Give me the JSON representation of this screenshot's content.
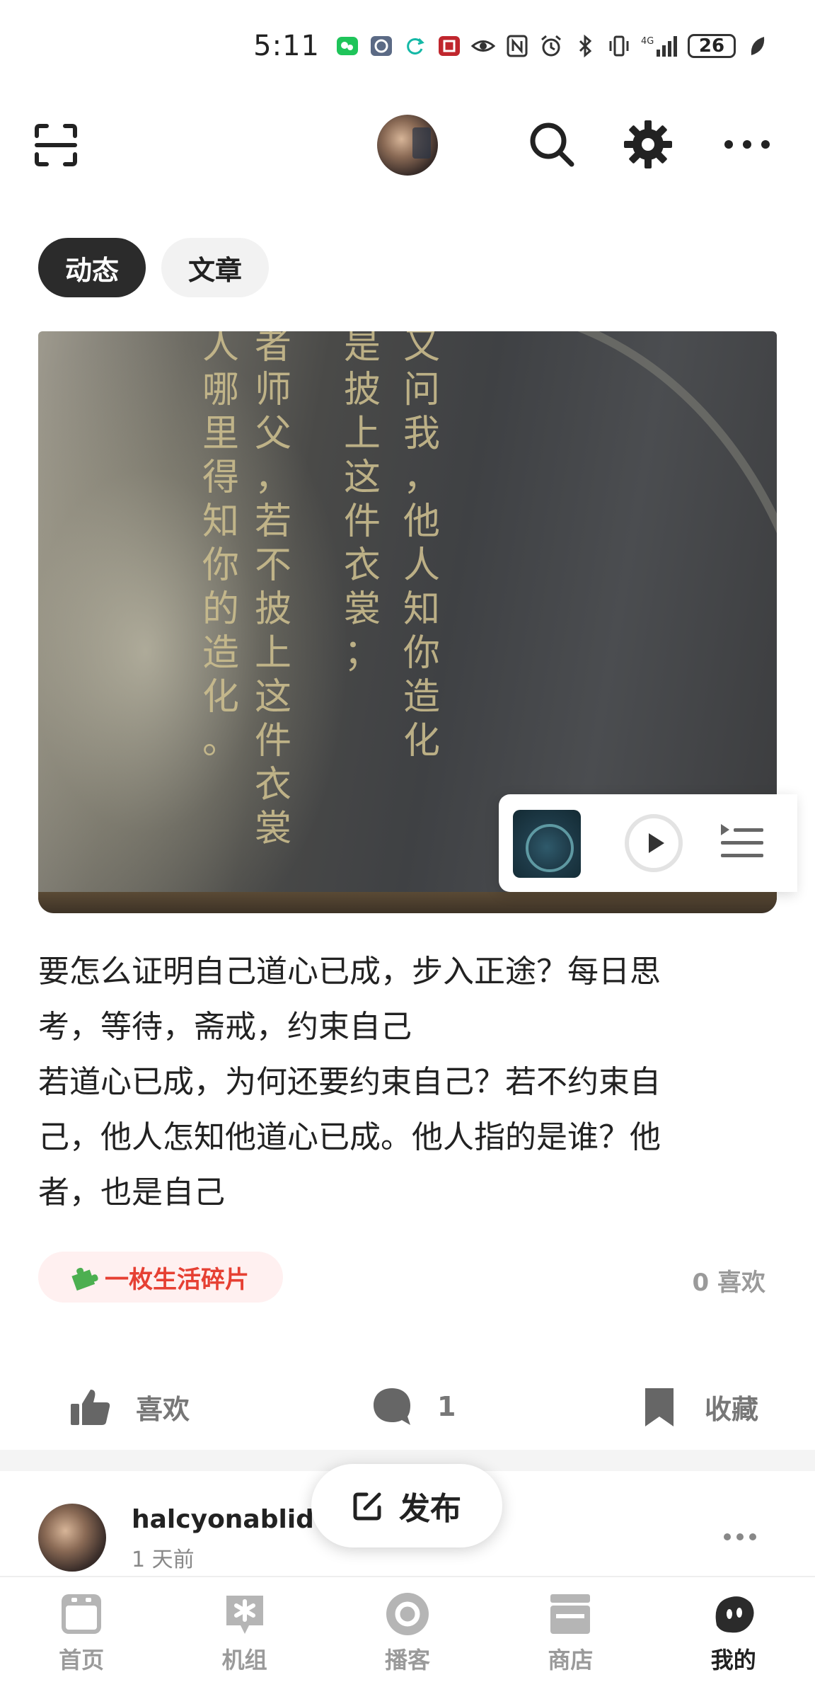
{
  "status_bar": {
    "time": "5:11",
    "battery": "26",
    "icons": [
      "wechat-icon",
      "app-icon",
      "sync-icon",
      "app-red-icon",
      "eye-icon",
      "nfc-icon",
      "alarm-icon",
      "bluetooth-icon",
      "vibrate-icon",
      "signal-4g-icon",
      "leaf-icon"
    ]
  },
  "header": {
    "icons": [
      "scan-icon",
      "avatar",
      "search-icon",
      "gear-icon",
      "more-icon"
    ]
  },
  "tabs": [
    {
      "label": "动态",
      "active": true
    },
    {
      "label": "文章",
      "active": false
    }
  ],
  "post": {
    "image_text_columns": [
      "人哪里得知你的造化。",
      "者师父，若不披上这件衣裳",
      "是披上这件衣裳；",
      "又问我，他人知你造化"
    ],
    "text_lines": [
      "要怎么证明自己道心已成，步入正途？每日思",
      "考，等待，斋戒，约束自己",
      "若道心已成，为何还要约束自己？若不约束自",
      "己，他人怎知他道心已成。他人指的是谁？他",
      "者，也是自己"
    ],
    "topic": "一枚生活碎片",
    "likes_summary": "0 喜欢",
    "actions": {
      "like": "喜欢",
      "comment_count": "1",
      "favorite": "收藏"
    }
  },
  "mini_player": {
    "icons": [
      "album-cover",
      "play-icon",
      "playlist-icon"
    ]
  },
  "next_post": {
    "username": "halcyonablid",
    "time": "1 天前"
  },
  "publish_button": "发布",
  "bottom_nav": [
    {
      "label": "首页",
      "icon": "home-icon",
      "active": false
    },
    {
      "label": "机组",
      "icon": "crew-icon",
      "active": false
    },
    {
      "label": "播客",
      "icon": "podcast-icon",
      "active": false
    },
    {
      "label": "商店",
      "icon": "store-icon",
      "active": false
    },
    {
      "label": "我的",
      "icon": "profile-icon",
      "active": true
    }
  ],
  "colors": {
    "accent_red": "#e64033",
    "tab_active_bg": "#2b2b2b",
    "muted": "#9a9a9a"
  }
}
